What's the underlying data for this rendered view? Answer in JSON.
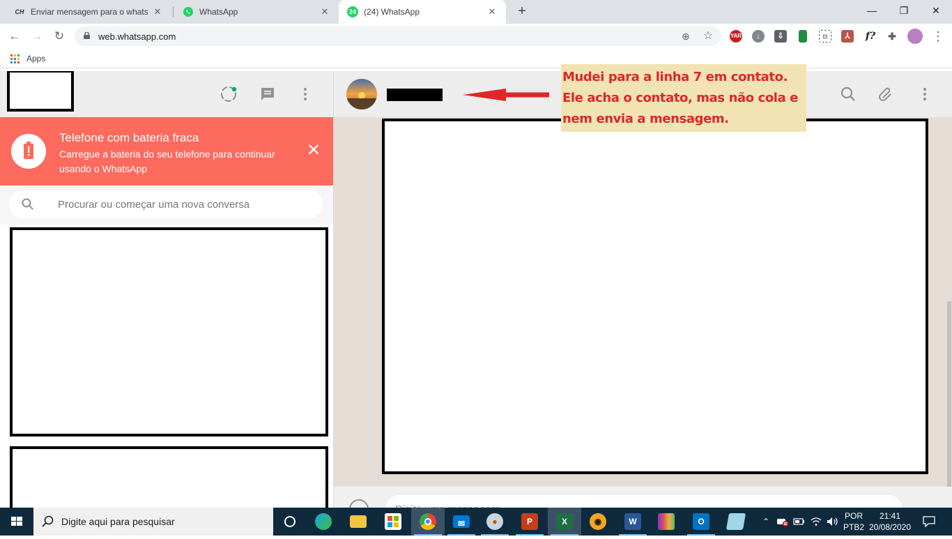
{
  "browser": {
    "tabs": [
      {
        "title": "Enviar mensagem para o whatsapp",
        "favicon": "CH",
        "active": false
      },
      {
        "title": "WhatsApp",
        "favicon": "whatsapp-logo",
        "active": false
      },
      {
        "title": "(24) WhatsApp",
        "favicon": "24",
        "active": true
      }
    ],
    "url": "web.whatsapp.com",
    "bookmarks": {
      "apps_label": "Apps"
    },
    "extensions": [
      "YAR",
      "download",
      "save",
      "book",
      "screenshot",
      "pdf",
      "f?",
      "puzzle",
      "profile"
    ]
  },
  "left": {
    "battery": {
      "title": "Telefone com bateria fraca",
      "description": "Carregue a bateria do seu telefone para continuar usando o WhatsApp"
    },
    "search": {
      "placeholder": "Procurar ou começar uma nova conversa"
    }
  },
  "chat": {
    "input_placeholder": "Digite uma mensagem"
  },
  "annotation": {
    "lines": [
      "Mudei para a linha 7 em contato.",
      "Ele acha o contato, mas não cola e",
      "nem envia a mensagem."
    ],
    "color": "#e0262a",
    "background": "#f2e3b3"
  },
  "taskbar": {
    "search_text": "Digite aqui para pesquisar",
    "lang_top": "POR",
    "lang_bottom": "PTB2",
    "time": "21:41",
    "date": "20/08/2020"
  },
  "colors": {
    "battery_banner": "#fd6a5e",
    "whatsapp_green": "#25d366",
    "status_dot": "#00a884"
  }
}
